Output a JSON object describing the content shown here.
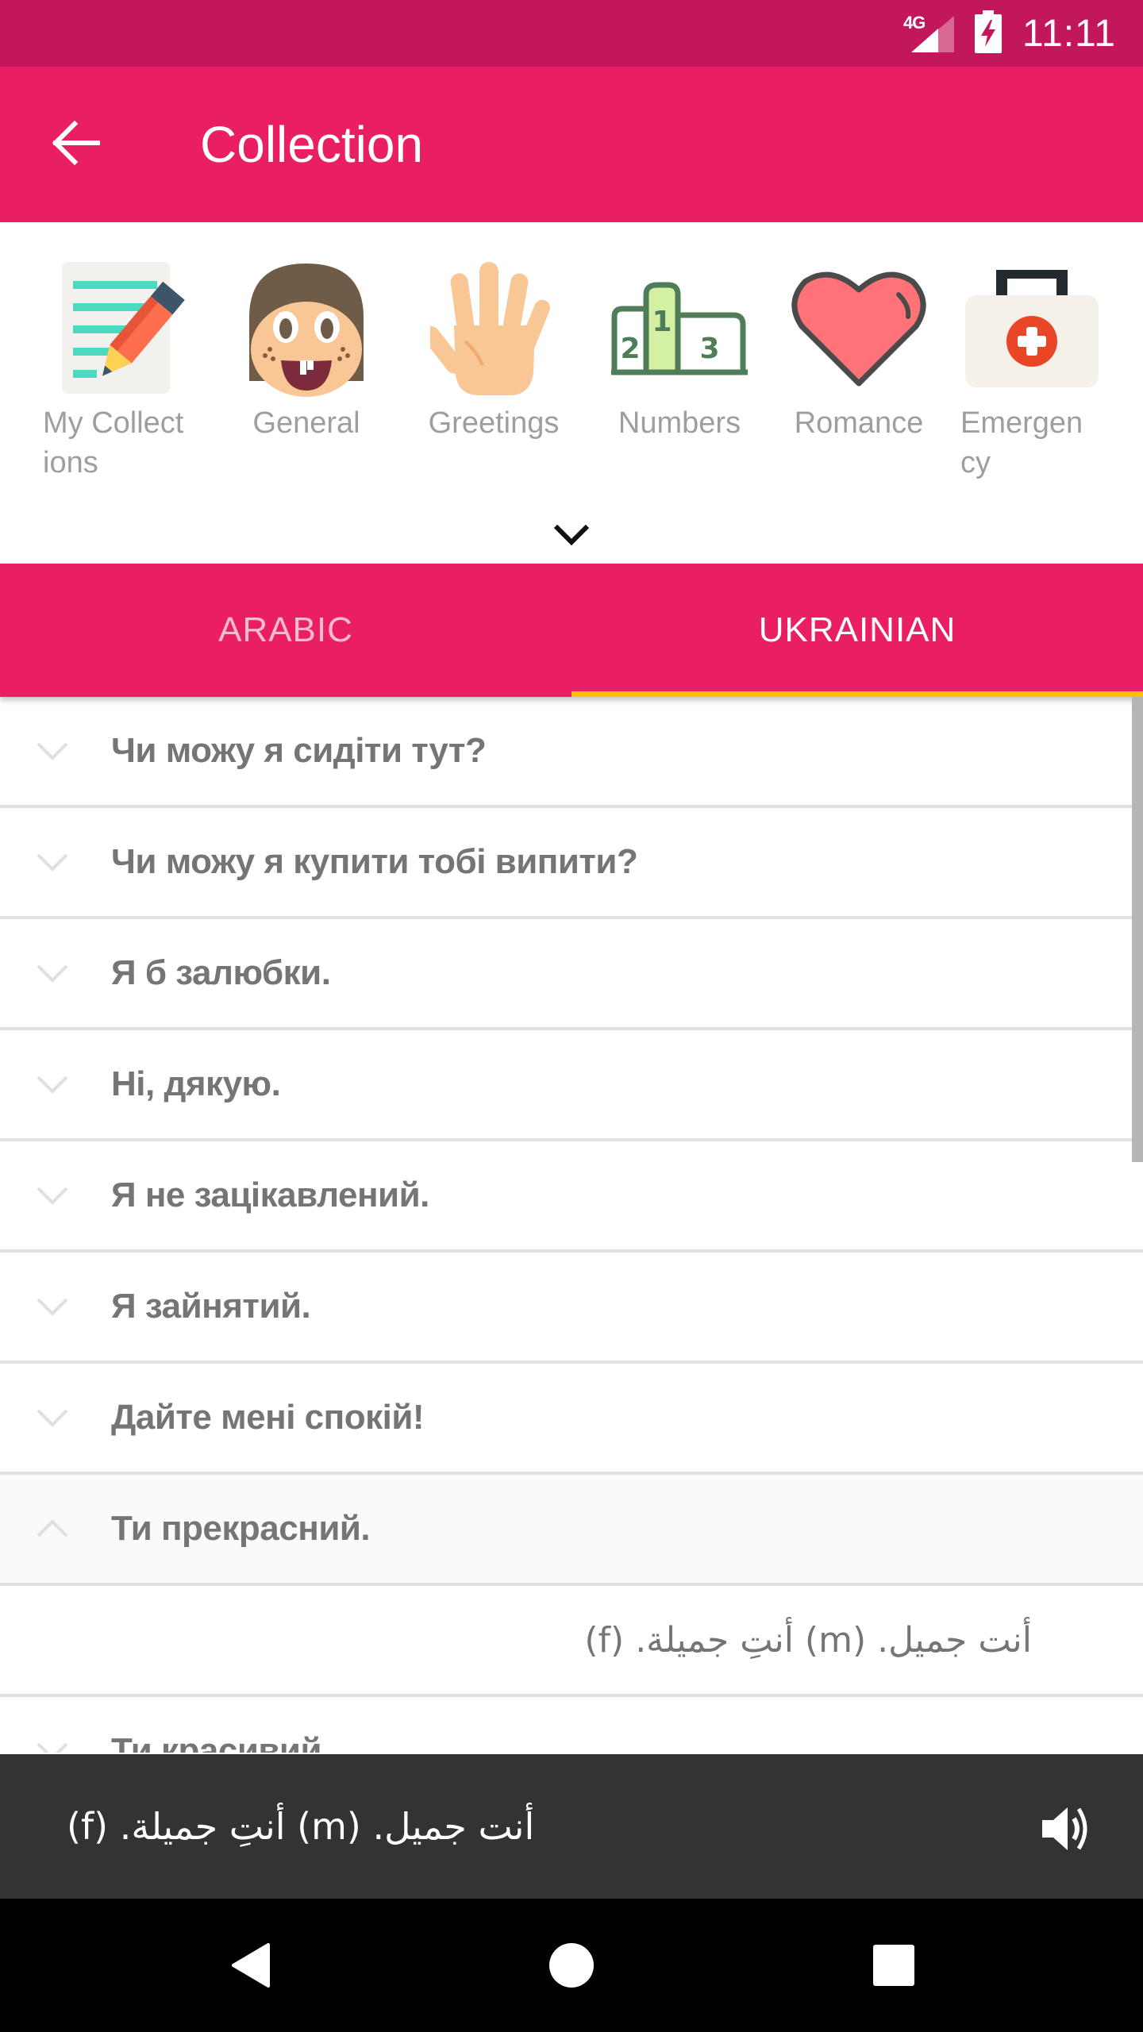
{
  "status_bar": {
    "network": "4G",
    "time": "11:11",
    "icons": [
      "signal-icon",
      "battery-charging-icon"
    ]
  },
  "app_bar": {
    "back_icon": "arrow-left-icon",
    "title": "Collection"
  },
  "categories": [
    {
      "label": "My Collect\nions",
      "icon": "notepad-pencil-icon"
    },
    {
      "label": "General",
      "icon": "smiling-face-icon"
    },
    {
      "label": "Greetings",
      "icon": "waving-hand-icon"
    },
    {
      "label": "Numbers",
      "icon": "podium-icon"
    },
    {
      "label": "Romance",
      "icon": "heart-icon"
    },
    {
      "label": "Emergen\ncy",
      "icon": "first-aid-kit-icon"
    }
  ],
  "expand_icon": "chevron-down-icon",
  "tabs": [
    {
      "label": "ARABIC",
      "active": false
    },
    {
      "label": "UKRAINIAN",
      "active": true
    }
  ],
  "colors": {
    "status_bar": "#c2185b",
    "primary": "#e91e63",
    "tab_indicator": "#ffc107",
    "player_bg": "#333333",
    "text_gray": "#757575"
  },
  "phrases": [
    {
      "text": "Чи можу я сидіти тут?",
      "expanded": false
    },
    {
      "text": "Чи можу я купити тобі випити?",
      "expanded": false
    },
    {
      "text": "Я б залюбки.",
      "expanded": false
    },
    {
      "text": "Ні, дякую.",
      "expanded": false
    },
    {
      "text": "Я не зацікавлений.",
      "expanded": false
    },
    {
      "text": "Я зайнятий.",
      "expanded": false
    },
    {
      "text": "Дайте мені спокій!",
      "expanded": false
    },
    {
      "text": "Ти прекрасний.",
      "expanded": true,
      "translation": "أنت جميل. (m)  أنتِ جميلة. (f)"
    },
    {
      "text": "Ти красивий.",
      "expanded": false
    }
  ],
  "player": {
    "translation": "أنت جميل. (m)  أنتِ جميلة. (f)",
    "speaker_icon": "speaker-icon"
  },
  "nav_bar": {
    "icons": [
      "back-triangle-icon",
      "home-circle-icon",
      "recents-square-icon"
    ]
  }
}
